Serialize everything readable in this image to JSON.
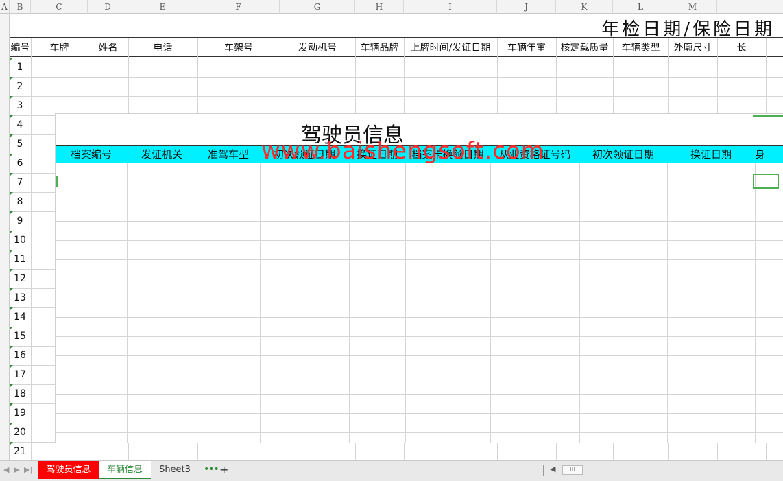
{
  "sheet": {
    "columns": [
      "A",
      "B",
      "C",
      "D",
      "E",
      "F",
      "G",
      "H",
      "I",
      "J",
      "K",
      "L",
      "M"
    ],
    "title": "年检日期/保险日期",
    "headers": [
      "编号",
      "车牌",
      "姓名",
      "电话",
      "车架号",
      "发动机号",
      "车辆品牌",
      "上牌时间/发证日期",
      "车辆年审",
      "核定载质量",
      "车辆类型",
      "外廓尺寸",
      "长"
    ],
    "rows": [
      "1",
      "2",
      "3",
      "4",
      "5",
      "6",
      "7",
      "8",
      "9",
      "10",
      "11",
      "12",
      "13",
      "14",
      "15",
      "16",
      "17",
      "18",
      "19",
      "20",
      "21"
    ]
  },
  "overlay": {
    "title": "驾驶员信息",
    "headers": [
      "档案编号",
      "发证机关",
      "准驾车型",
      "初次领证日期",
      "换证日期",
      "档案卡换领日期",
      "从业资格证号码",
      "初次领证日期",
      "换证日期",
      "身"
    ],
    "watermark": "www.baishengsoft.com"
  },
  "tabs": {
    "items": [
      {
        "label": "驾驶员信息",
        "color": "#ff0000"
      },
      {
        "label": "车辆信息",
        "color": "#2e8b3a"
      },
      {
        "label": "Sheet3"
      }
    ],
    "more": "•••",
    "add": "+",
    "scroll_thumb": "III"
  }
}
